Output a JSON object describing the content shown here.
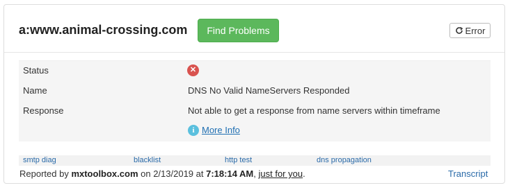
{
  "header": {
    "title": "a:www.animal-crossing.com",
    "find_button": "Find Problems",
    "error_button": "Error"
  },
  "details": {
    "status_label": "Status",
    "status_icon": "error-circle-icon",
    "name_label": "Name",
    "name_value": "DNS No Valid NameServers Responded",
    "response_label": "Response",
    "response_value": "Not able to get a response from name servers within timeframe",
    "more_info": "More Info"
  },
  "links": [
    "smtp diag",
    "blacklist",
    "http test",
    "dns propagation"
  ],
  "footer": {
    "prefix": "Reported by ",
    "site": "mxtoolbox.com",
    "on": " on 2/13/2019 at ",
    "time": "7:18:14 AM",
    "sep": ", ",
    "just_for_you": "just for you",
    "end": ".",
    "transcript": "Transcript"
  },
  "colors": {
    "find_button": "#5cb85c",
    "error_icon": "#d9534f",
    "info_icon": "#5bc0de",
    "link": "#2a6aa8"
  }
}
